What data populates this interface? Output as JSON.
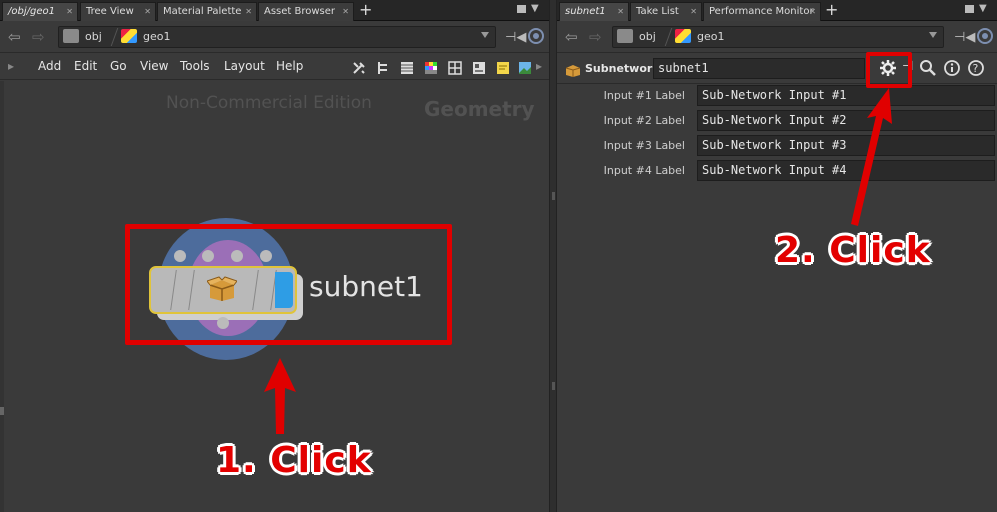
{
  "left_pane": {
    "tabs": [
      {
        "label": "/obj/geo1",
        "active": true
      },
      {
        "label": "Tree View",
        "active": false
      },
      {
        "label": "Material Palette",
        "active": false
      },
      {
        "label": "Asset Browser",
        "active": false
      }
    ],
    "path": {
      "obj": "obj",
      "geo": "geo1"
    },
    "menu": [
      "Add",
      "Edit",
      "Go",
      "View",
      "Tools",
      "Layout",
      "Help"
    ],
    "watermark": "Non-Commercial Edition",
    "context_label": "Geometry",
    "node": {
      "name": "subnet1"
    }
  },
  "right_pane": {
    "tabs": [
      {
        "label": "subnet1",
        "active": true
      },
      {
        "label": "Take List",
        "active": false
      },
      {
        "label": "Performance Monitor",
        "active": false
      }
    ],
    "path": {
      "obj": "obj",
      "geo": "geo1"
    },
    "parm_header": {
      "type_label": "Subnetwork",
      "node_name": "subnet1"
    },
    "parms": [
      {
        "label": "Input #1 Label",
        "value": "Sub-Network Input #1"
      },
      {
        "label": "Input #2 Label",
        "value": "Sub-Network Input #2"
      },
      {
        "label": "Input #3 Label",
        "value": "Sub-Network Input #3"
      },
      {
        "label": "Input #4 Label",
        "value": "Sub-Network Input #4"
      }
    ]
  },
  "annotations": {
    "step1": "1. Click",
    "step2": "2. Click"
  },
  "colors": {
    "annotation": "#e00000",
    "node_selected": "#e0c43a",
    "node_blue": "#2e9de5"
  }
}
